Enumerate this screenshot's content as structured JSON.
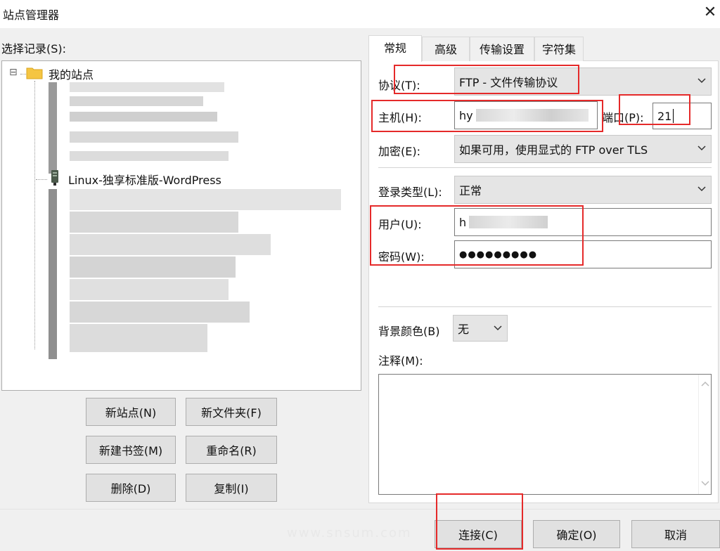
{
  "window": {
    "title": "站点管理器",
    "close_glyph": "✕"
  },
  "left": {
    "select_entry_label": "选择记录(S):",
    "tree": {
      "root_label": "我的站点",
      "expander_glyph": "⊟",
      "visible_site_label": "Linux-独享标准版-WordPress"
    },
    "buttons": {
      "new_site": "新站点(N)",
      "new_folder": "新文件夹(F)",
      "new_bookmark": "新建书签(M)",
      "rename": "重命名(R)",
      "delete": "删除(D)",
      "copy": "复制(I)"
    }
  },
  "tabs": [
    "常规",
    "高级",
    "传输设置",
    "字符集"
  ],
  "general": {
    "protocol_label": "协议(T):",
    "protocol_value": "FTP - 文件传输协议",
    "host_label": "主机(H):",
    "host_value": "hy",
    "port_label": "端口(P):",
    "port_value": "21",
    "encryption_label": "加密(E):",
    "encryption_value": "如果可用，使用显式的 FTP over TLS",
    "login_type_label": "登录类型(L):",
    "login_type_value": "正常",
    "user_label": "用户(U):",
    "user_value": "h",
    "password_label": "密码(W):",
    "password_value": "●●●●●●●●●",
    "bg_color_label": "背景颜色(B)",
    "bg_color_value": "无",
    "comments_label": "注释(M):",
    "comments_value": ""
  },
  "footer": {
    "connect": "连接(C)",
    "ok": "确定(O)",
    "cancel": "取消",
    "watermark": "www.snsum.com"
  },
  "colors": {
    "highlight_red": "#e52a2a",
    "folder_yellow": "#f5c542"
  }
}
